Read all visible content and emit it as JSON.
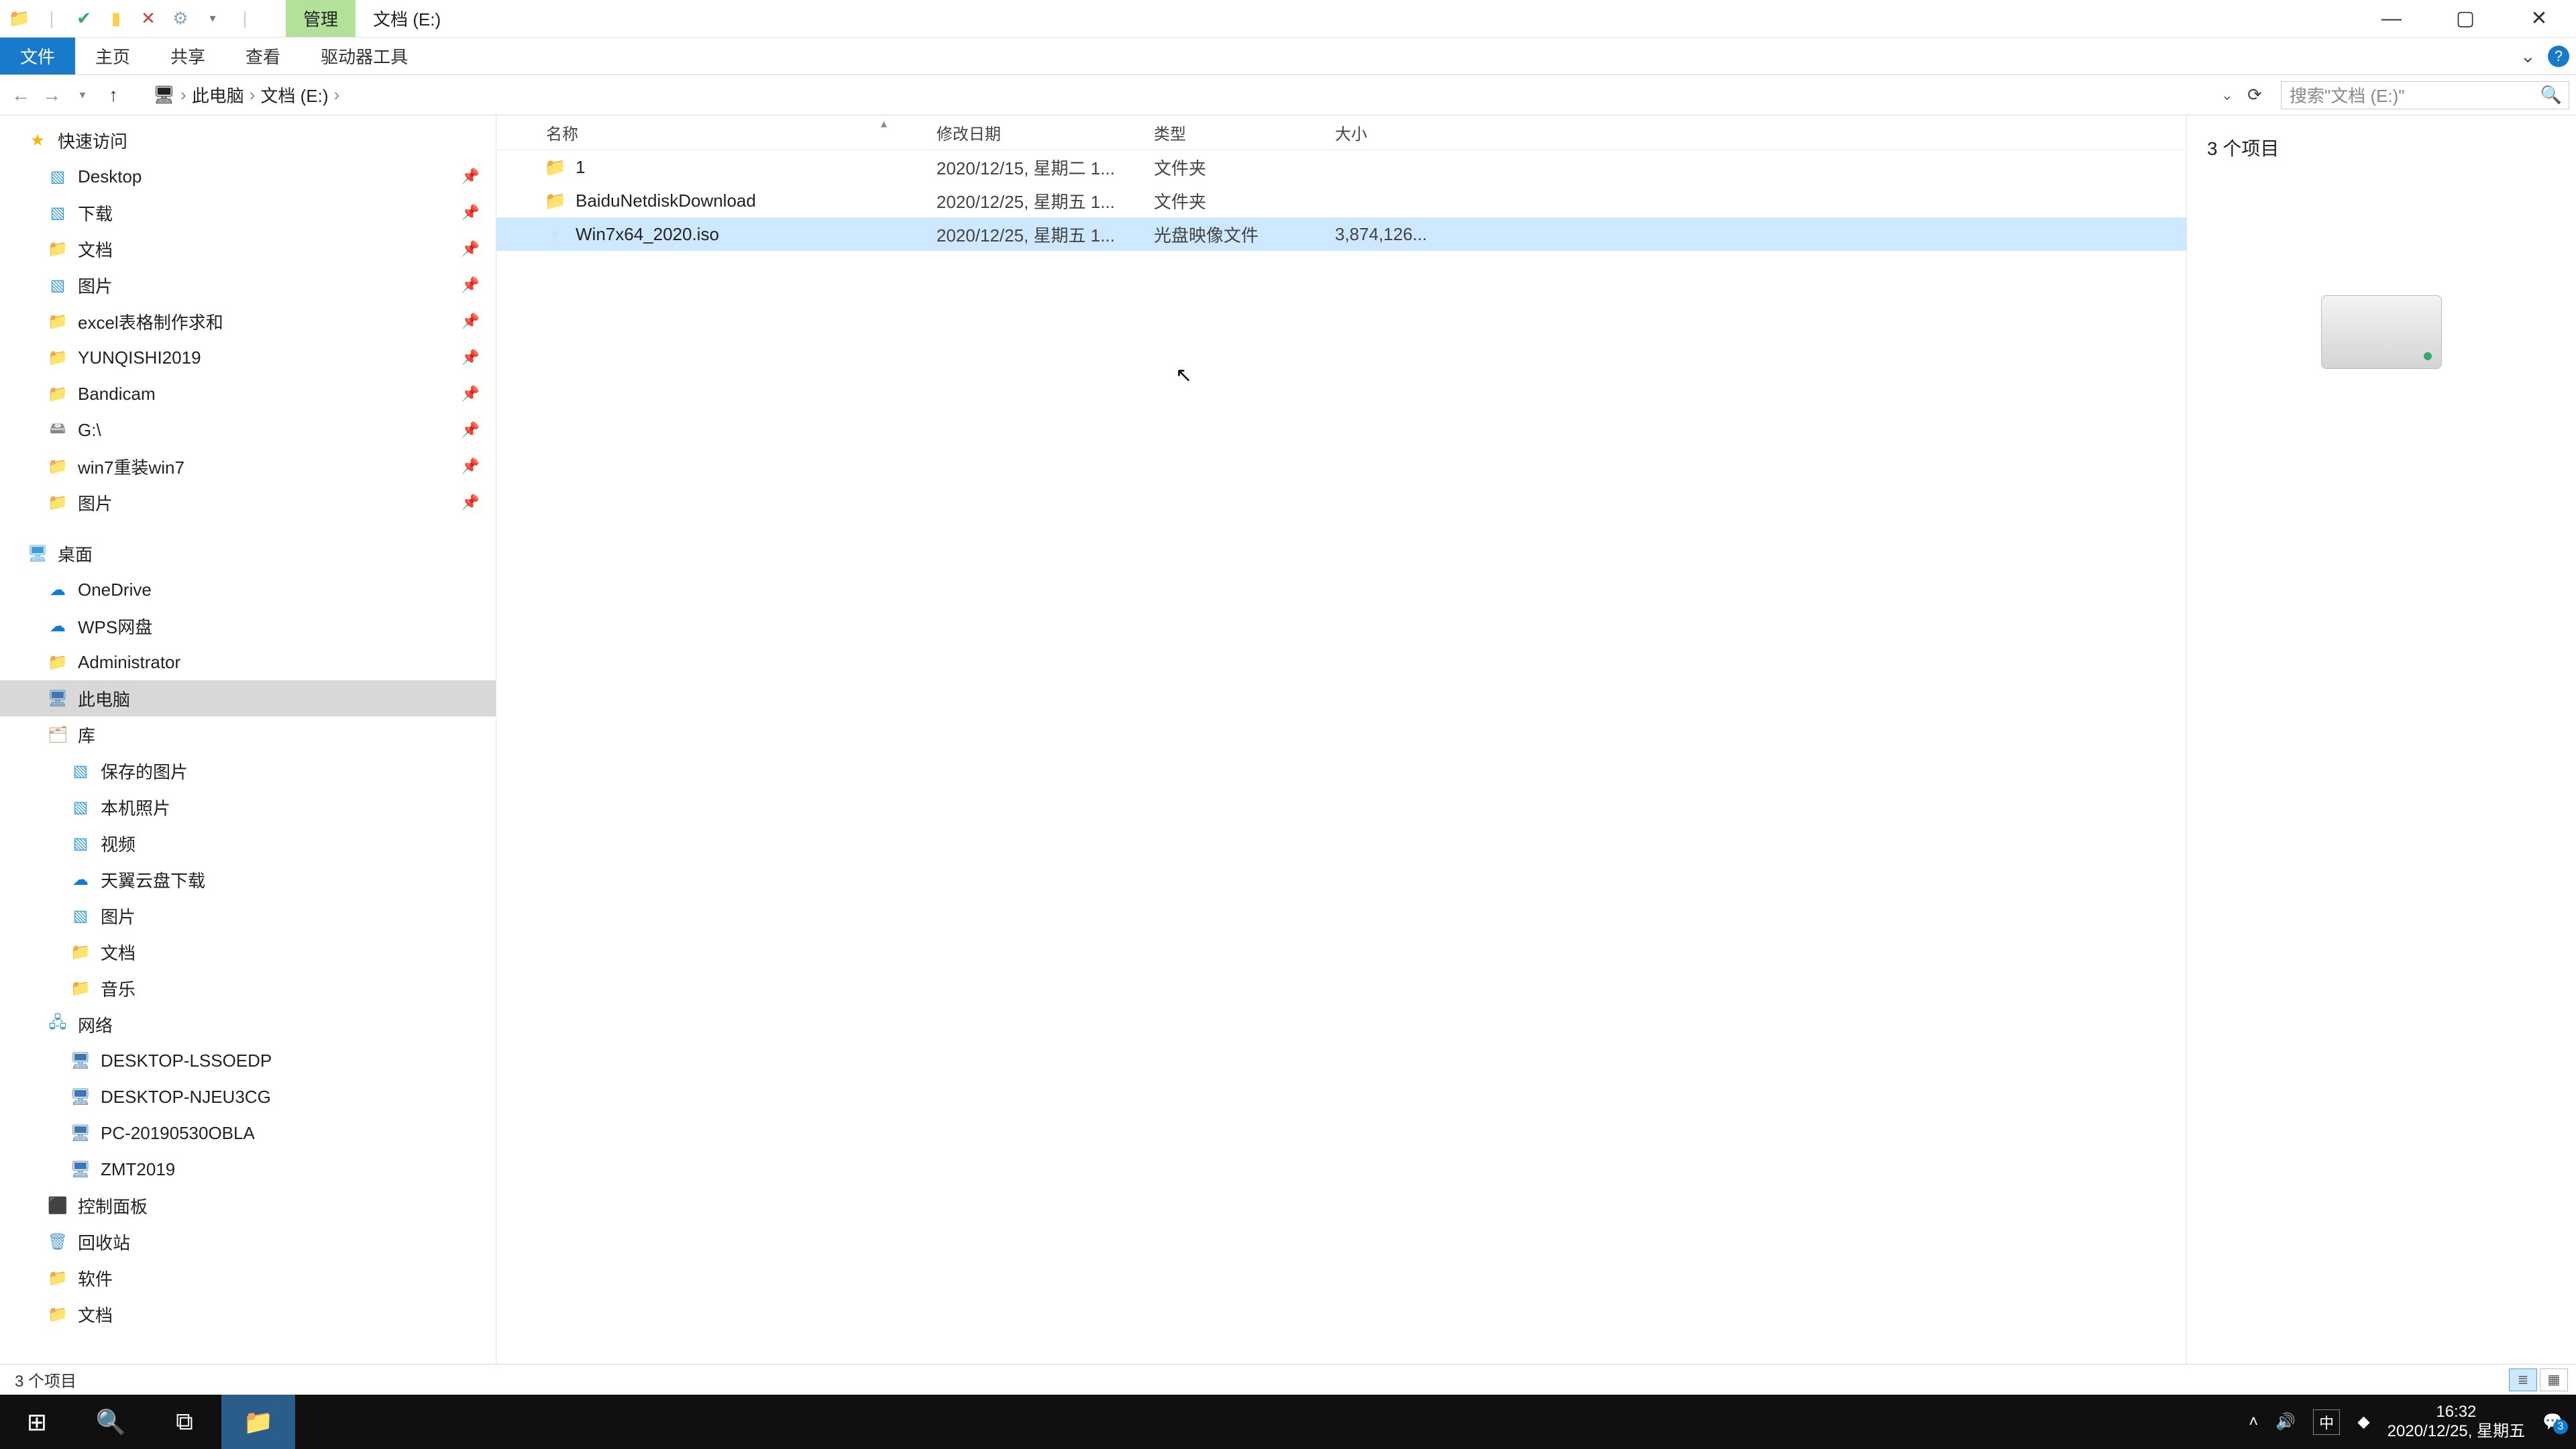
{
  "titlebar": {
    "manage_tab": "管理",
    "location_tab": "文档 (E:)"
  },
  "ribbon": {
    "file": "文件",
    "home": "主页",
    "share": "共享",
    "view": "查看",
    "drive_tools": "驱动器工具"
  },
  "navbar": {
    "crumbs": [
      "此电脑",
      "文档 (E:)"
    ],
    "search_placeholder": "搜索\"文档 (E:)\""
  },
  "columns": {
    "name": "名称",
    "date": "修改日期",
    "type": "类型",
    "size": "大小"
  },
  "rows": [
    {
      "icon": "fold",
      "name": "1",
      "date": "2020/12/15, 星期二 1...",
      "type": "文件夹",
      "size": ""
    },
    {
      "icon": "fold",
      "name": "BaiduNetdiskDownload",
      "date": "2020/12/25, 星期五 1...",
      "type": "文件夹",
      "size": ""
    },
    {
      "icon": "file",
      "name": "Win7x64_2020.iso",
      "date": "2020/12/25, 星期五 1...",
      "type": "光盘映像文件",
      "size": "3,874,126..."
    }
  ],
  "selected_row_index": 2,
  "sidebar": {
    "quick_access": "快速访问",
    "qa_items": [
      {
        "ico": "blue",
        "label": "Desktop"
      },
      {
        "ico": "blue",
        "label": "下载"
      },
      {
        "ico": "folder",
        "label": "文档"
      },
      {
        "ico": "blue",
        "label": "图片"
      },
      {
        "ico": "folder",
        "label": "excel表格制作求和"
      },
      {
        "ico": "folder",
        "label": "YUNQISHI2019"
      },
      {
        "ico": "folder",
        "label": "Bandicam"
      },
      {
        "ico": "drive",
        "label": "G:\\"
      },
      {
        "ico": "folder",
        "label": "win7重装win7"
      },
      {
        "ico": "folder",
        "label": "图片"
      }
    ],
    "desktop": "桌面",
    "desktop_items": [
      {
        "ico": "cloud",
        "label": "OneDrive"
      },
      {
        "ico": "cloud",
        "label": "WPS网盘"
      },
      {
        "ico": "folder",
        "label": "Administrator"
      },
      {
        "ico": "pc",
        "label": "此电脑",
        "selected": true
      },
      {
        "ico": "lib",
        "label": "库"
      }
    ],
    "lib_items": [
      {
        "ico": "blue",
        "label": "保存的图片"
      },
      {
        "ico": "blue",
        "label": "本机照片"
      },
      {
        "ico": "blue",
        "label": "视频"
      },
      {
        "ico": "cloud",
        "label": "天翼云盘下载"
      },
      {
        "ico": "blue",
        "label": "图片"
      },
      {
        "ico": "folder",
        "label": "文档"
      },
      {
        "ico": "folder",
        "label": "音乐"
      }
    ],
    "network": "网络",
    "net_items": [
      {
        "ico": "pc",
        "label": "DESKTOP-LSSOEDP"
      },
      {
        "ico": "pc",
        "label": "DESKTOP-NJEU3CG"
      },
      {
        "ico": "pc",
        "label": "PC-20190530OBLA"
      },
      {
        "ico": "pc",
        "label": "ZMT2019"
      }
    ],
    "control_panel": "控制面板",
    "recycle": "回收站",
    "software": "软件",
    "docs2": "文档"
  },
  "preview": {
    "count": "3 个项目"
  },
  "status": {
    "count": "3 个项目"
  },
  "taskbar": {
    "time": "16:32",
    "date": "2020/12/25, 星期五",
    "ime": "中",
    "notif_count": "3"
  }
}
